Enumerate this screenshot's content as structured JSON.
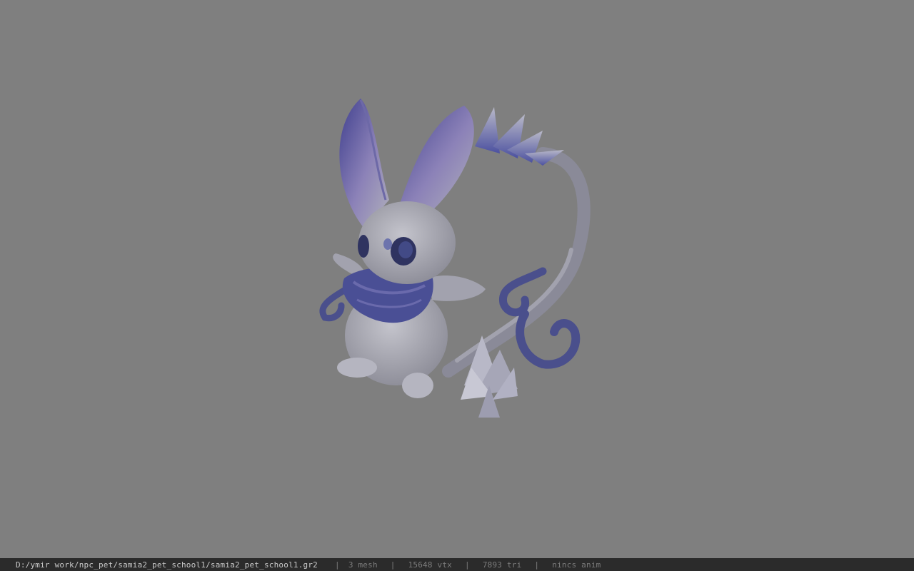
{
  "viewport": {
    "background": "#7f7f7f",
    "model_icon": "creature-model-icon"
  },
  "statusbar": {
    "path": "D:/ymir work/npc_pet/samia2_pet_school1/samia2_pet_school1.gr2",
    "separator": "|",
    "mesh": "3 mesh",
    "vtx": "15648 vtx",
    "tri": "7893 tri",
    "anim": "nincs anim"
  },
  "colors": {
    "body": "#a9a9b3",
    "accent": "#4b4f96",
    "status_bg": "#2b2b2b",
    "path_text": "#c9c9c9"
  }
}
